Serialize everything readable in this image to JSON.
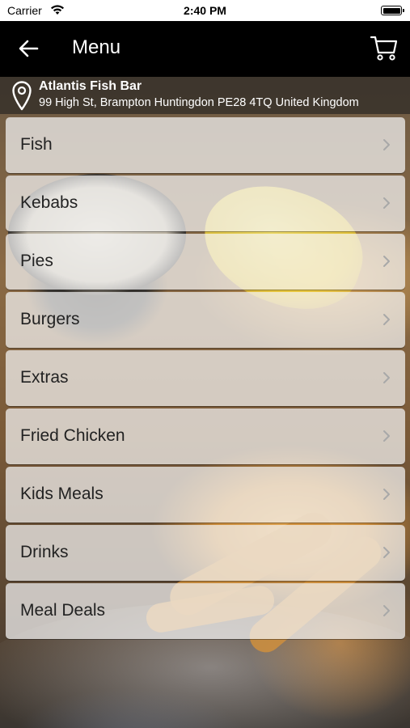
{
  "status_bar": {
    "carrier": "Carrier",
    "time": "2:40 PM",
    "wifi_icon": "wifi-icon",
    "battery_icon": "battery-full-icon"
  },
  "header": {
    "title": "Menu",
    "back_icon": "arrow-left-icon",
    "cart_icon": "shopping-cart-icon"
  },
  "restaurant": {
    "name": "Atlantis Fish Bar",
    "address": "99 High St, Brampton Huntingdon PE28 4TQ United Kingdom",
    "location_icon": "location-pin-icon"
  },
  "menu": {
    "items": [
      {
        "label": "Fish"
      },
      {
        "label": "Kebabs"
      },
      {
        "label": "Pies"
      },
      {
        "label": "Burgers"
      },
      {
        "label": "Extras"
      },
      {
        "label": "Fried Chicken"
      },
      {
        "label": "Kids Meals"
      },
      {
        "label": "Drinks"
      },
      {
        "label": "Meal Deals"
      }
    ],
    "chevron_icon": "chevron-right-icon"
  },
  "colors": {
    "header_bg": "#000000",
    "status_bg": "#ffffff",
    "item_bg": "rgba(245,245,245,0.72)",
    "item_text": "#222222"
  }
}
